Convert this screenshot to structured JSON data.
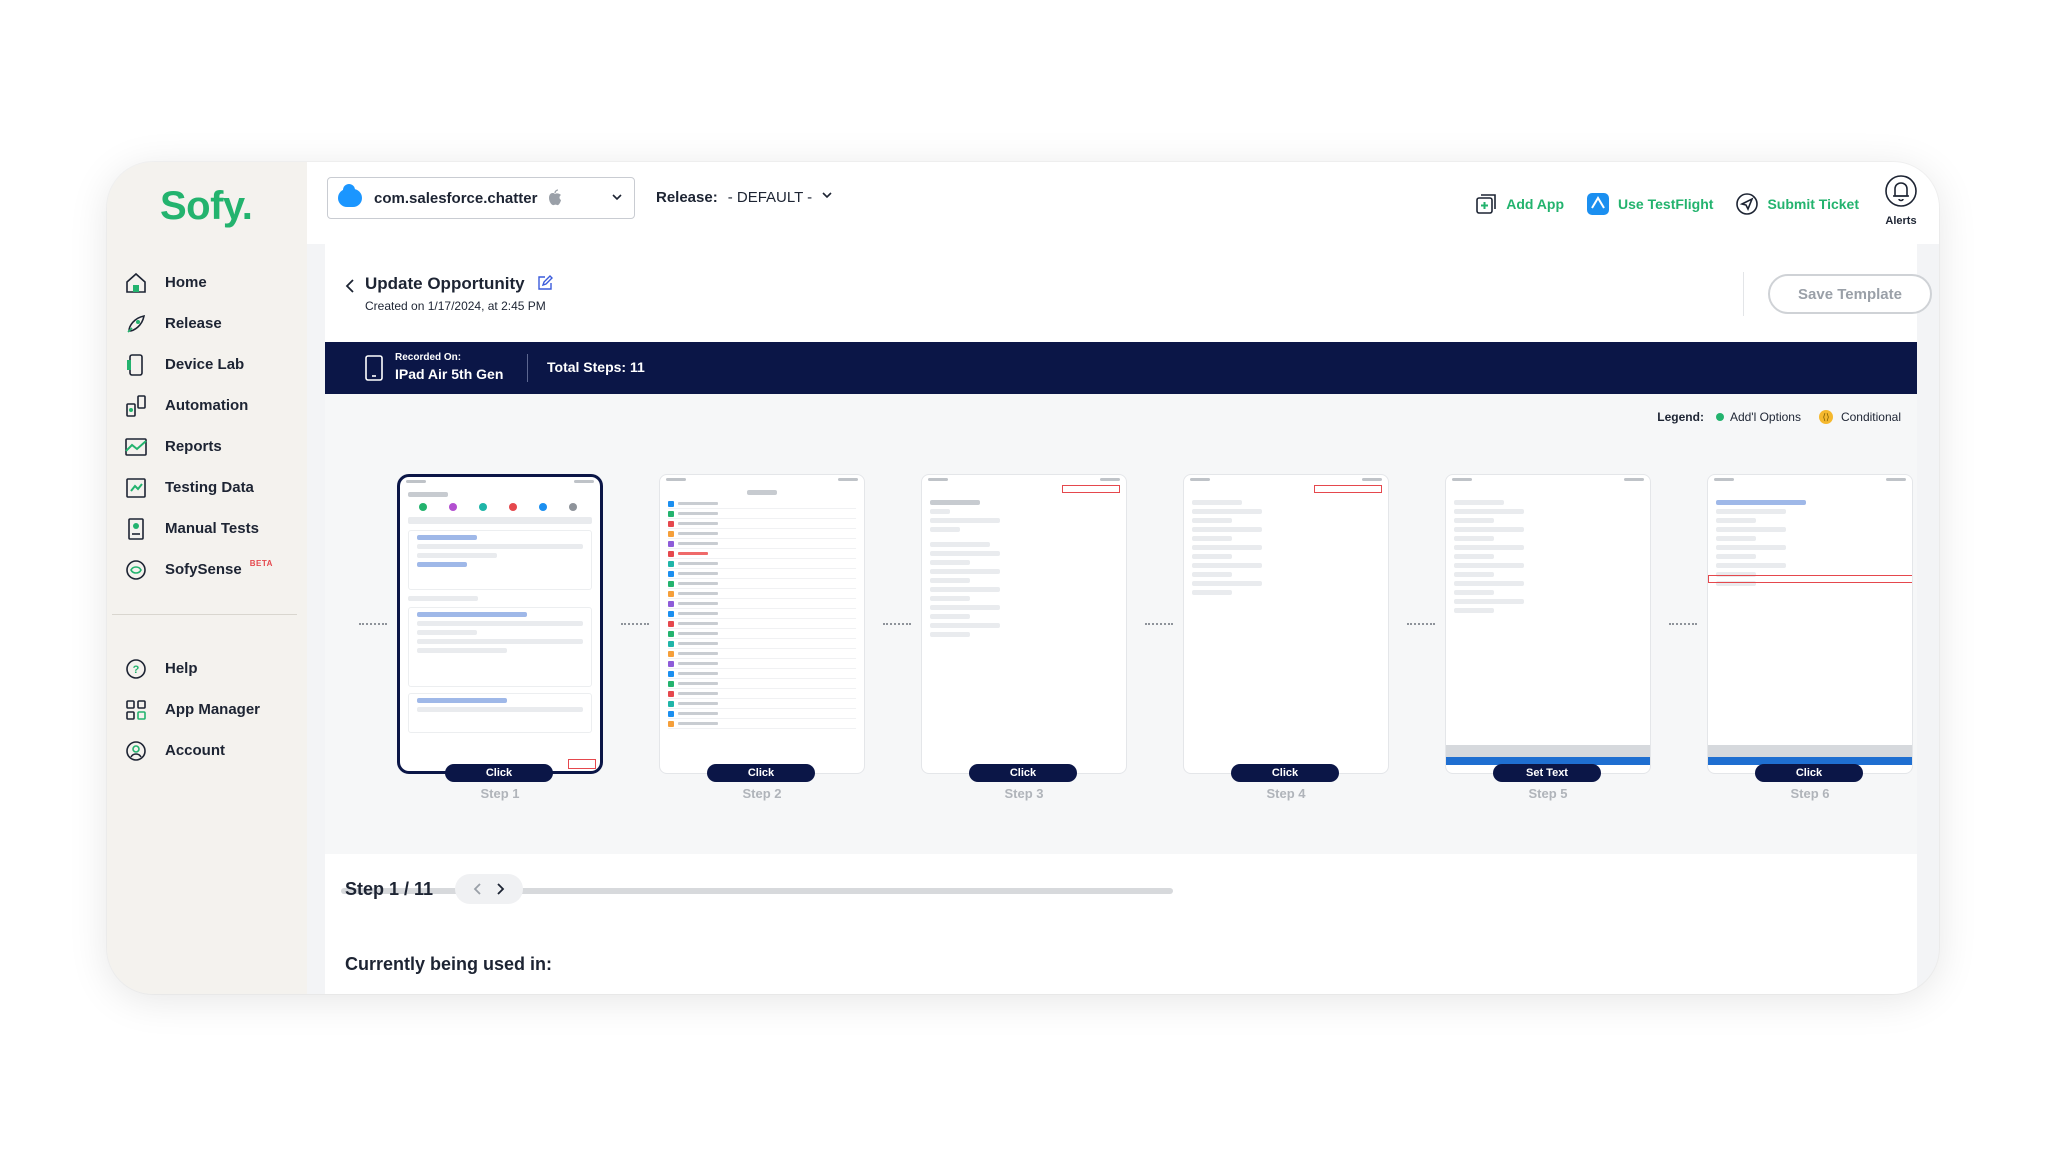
{
  "brand": {
    "logo": "Sofy.",
    "accent": "#23b36e",
    "navy": "#0b1647"
  },
  "sidebar": {
    "items": [
      {
        "label": "Home",
        "icon": "home-icon"
      },
      {
        "label": "Release",
        "icon": "rocket-icon"
      },
      {
        "label": "Device Lab",
        "icon": "phone-icon"
      },
      {
        "label": "Automation",
        "icon": "automation-icon"
      },
      {
        "label": "Reports",
        "icon": "reports-icon"
      },
      {
        "label": "Testing Data",
        "icon": "testing-data-icon"
      },
      {
        "label": "Manual Tests",
        "icon": "manual-tests-icon"
      },
      {
        "label": "SofySense",
        "icon": "sofysense-icon",
        "badge": "BETA"
      }
    ],
    "bottom_items": [
      {
        "label": "Help",
        "icon": "help-icon"
      },
      {
        "label": "App Manager",
        "icon": "app-manager-icon"
      },
      {
        "label": "Account",
        "icon": "account-icon"
      }
    ]
  },
  "topbar": {
    "app": "com.salesforce.chatter",
    "release_label": "Release:",
    "release_value": "- DEFAULT -",
    "add_app": "Add App",
    "use_testflight": "Use TestFlight",
    "submit_ticket": "Submit Ticket",
    "alerts": "Alerts"
  },
  "page": {
    "title": "Update Opportunity",
    "subtitle": "Created on 1/17/2024, at 2:45 PM",
    "save_template": "Save Template"
  },
  "banner": {
    "recorded_on_label": "Recorded On:",
    "device": "IPad Air 5th Gen",
    "total_steps": "Total Steps: 11"
  },
  "legend": {
    "heading": "Legend:",
    "addl_options": "Add'l Options",
    "conditional": "Conditional"
  },
  "steps": [
    {
      "action": "Click",
      "label": "Step 1"
    },
    {
      "action": "Click",
      "label": "Step 2"
    },
    {
      "action": "Click",
      "label": "Step 3"
    },
    {
      "action": "Click",
      "label": "Step 4"
    },
    {
      "action": "Set Text",
      "label": "Step 5"
    },
    {
      "action": "Click",
      "label": "Step 6"
    }
  ],
  "step_nav": {
    "counter": "Step 1 / 11"
  },
  "used_in": {
    "heading": "Currently being used in:"
  }
}
